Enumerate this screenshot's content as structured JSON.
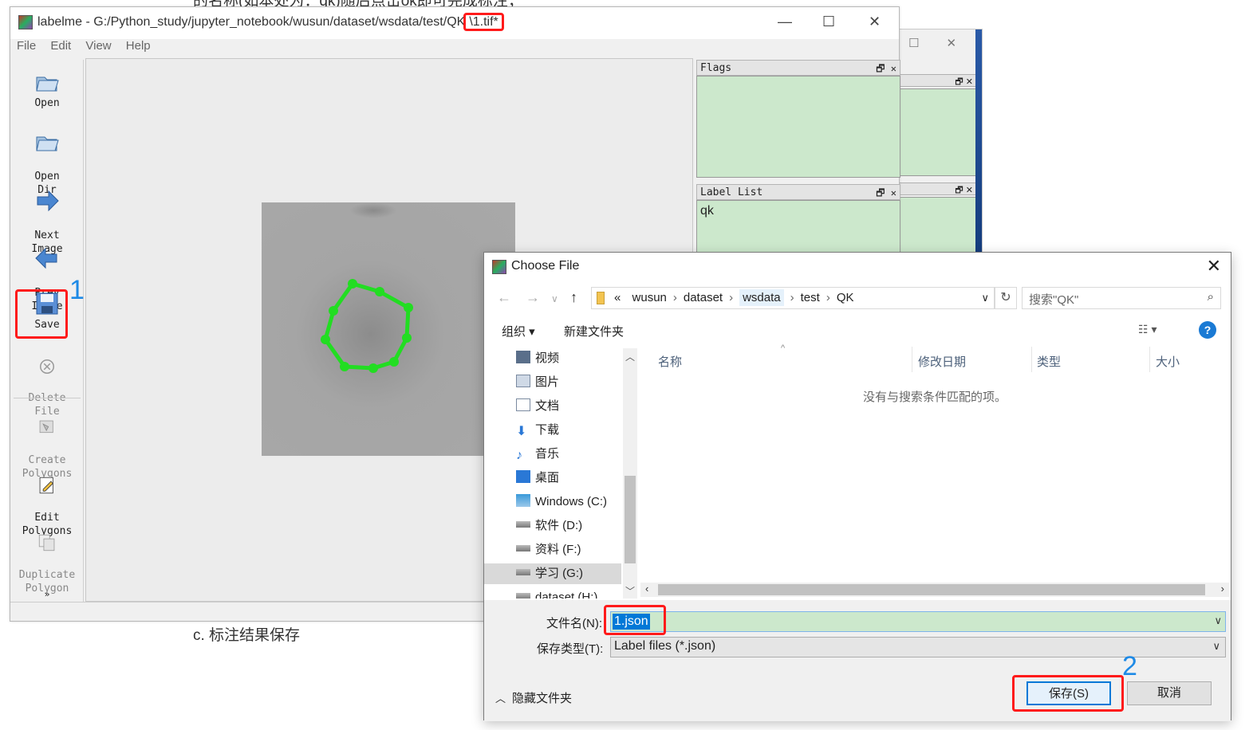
{
  "background": {
    "doc_text_top": "的名称(如本处为：qk)随后点击ok即可完成标注；",
    "caption": "c. 标注结果保存"
  },
  "labelme": {
    "title_prefix": "labelme - G:/Python_study/jupyter_notebook/wusun/dataset/wsdata/test/QK",
    "title_file": "\\1.tif*",
    "menu": [
      "File",
      "Edit",
      "View",
      "Help"
    ],
    "tools": {
      "open": "Open",
      "open_dir": "Open\nDir",
      "next_image": "Next\nImage",
      "prev_image": "Prev\nImage",
      "save": "Save",
      "delete_file": "Delete\nFile",
      "create_polygons": "Create\nPolygons",
      "edit_polygons": "Edit\nPolygons",
      "duplicate_polygon": "Duplicate\nPolygon"
    },
    "more_tools": "»",
    "flags_title": "Flags",
    "label_list_title": "Label List",
    "labels": [
      "qk"
    ],
    "annotation_step": "1"
  },
  "dialog": {
    "title": "Choose File",
    "breadcrumbs": [
      "«",
      "wusun",
      "dataset",
      "wsdata",
      "test",
      "QK"
    ],
    "search_placeholder": "搜索\"QK\"",
    "organize": "组织 ▾",
    "new_folder": "新建文件夹",
    "help": "?",
    "nav_items": [
      "视频",
      "图片",
      "文档",
      "下载",
      "音乐",
      "桌面",
      "Windows (C:)",
      "软件 (D:)",
      "资料 (F:)",
      "学习 (G:)",
      "dataset (H:)"
    ],
    "columns": [
      "名称",
      "修改日期",
      "类型",
      "大小"
    ],
    "empty_message": "没有与搜索条件匹配的项。",
    "filename_label": "文件名(N):",
    "filename_value": "1.json",
    "filetype_label": "保存类型(T):",
    "filetype_value": "Label files (*.json)",
    "hide_folders": "隐藏文件夹",
    "save_button": "保存(S)",
    "cancel_button": "取消",
    "save_step": "2"
  },
  "colors": {
    "highlight_red": "#ff1a1a",
    "step_blue": "#1e8ae6",
    "dock_green": "#cce8cc",
    "polygon_green": "#22dd22"
  }
}
